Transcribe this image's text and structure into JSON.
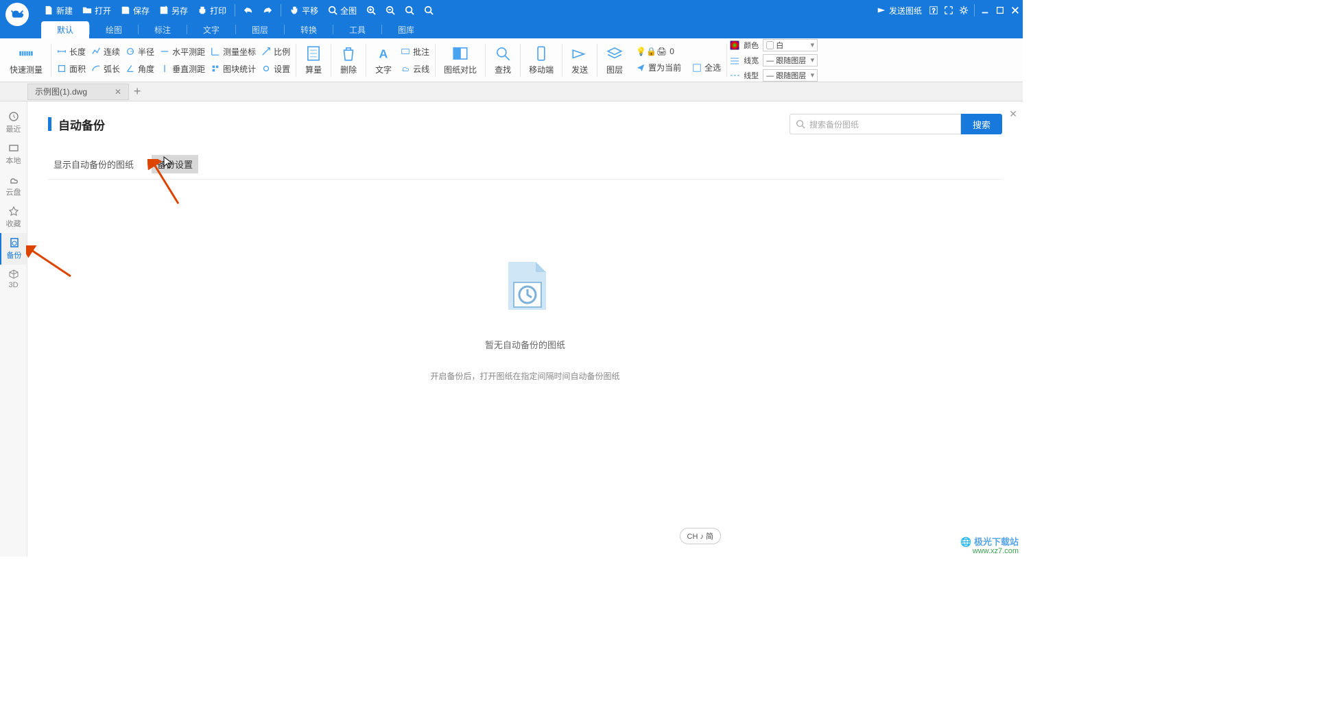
{
  "titlebar": {
    "new": "新建",
    "open": "打开",
    "save": "保存",
    "saveas": "另存",
    "print": "打印",
    "pan": "平移",
    "fit": "全图",
    "send": "发送图纸"
  },
  "menutabs": [
    "默认",
    "绘图",
    "标注",
    "文字",
    "图层",
    "转换",
    "工具",
    "图库"
  ],
  "ribbon": {
    "quickmeasure": "快速测量",
    "col1": [
      "长度",
      "面积"
    ],
    "col2": [
      "连续",
      "弧长"
    ],
    "col3": [
      "半径",
      "角度"
    ],
    "col4": [
      "水平测距",
      "垂直测距"
    ],
    "col5": [
      "测量坐标",
      "图块统计"
    ],
    "col6": [
      "比例",
      "设置"
    ],
    "big": [
      "算量",
      "删除",
      "文字",
      "云线",
      "图纸对比",
      "查找",
      "移动端",
      "发送",
      "图层"
    ],
    "batch": "批注",
    "layer": {
      "setcur": "置为当前",
      "selectall": "全选",
      "num": "0"
    },
    "props": {
      "color": "颜色",
      "colorval": "白",
      "lw": "线宽",
      "lwval": "跟随图层",
      "lt": "线型",
      "ltval": "跟随图层"
    }
  },
  "filetab": {
    "name": "示例图(1).dwg"
  },
  "sidebar": [
    "最近",
    "本地",
    "云盘",
    "收藏",
    "备份",
    "3D"
  ],
  "panel": {
    "title": "自动备份",
    "subtabs": [
      "显示自动备份的图纸",
      "备份设置"
    ],
    "search_ph": "搜索备份图纸",
    "search_btn": "搜索",
    "empty1": "暂无自动备份的图纸",
    "empty2": "开启备份后，打开图纸在指定间隔时间自动备份图纸",
    "ch": "CH ♪ 简"
  },
  "footer": {
    "brand": "极光下载站",
    "url": "www.xz7.com"
  }
}
